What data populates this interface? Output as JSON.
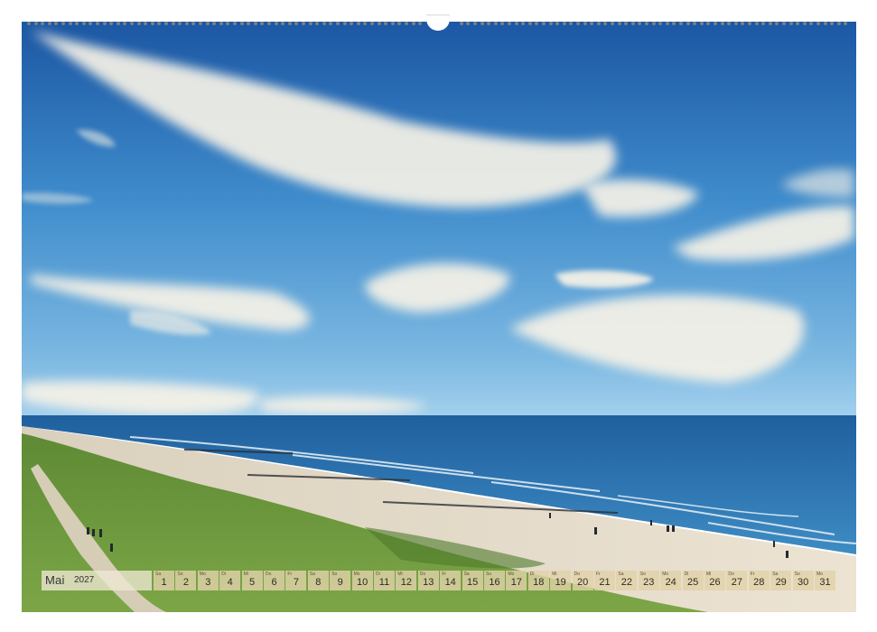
{
  "calendar": {
    "month": "Mai",
    "year": "2027",
    "days": [
      {
        "num": "1",
        "wd": "Sa"
      },
      {
        "num": "2",
        "wd": "So"
      },
      {
        "num": "3",
        "wd": "Mo"
      },
      {
        "num": "4",
        "wd": "Di"
      },
      {
        "num": "5",
        "wd": "Mi"
      },
      {
        "num": "6",
        "wd": "Do"
      },
      {
        "num": "7",
        "wd": "Fr"
      },
      {
        "num": "8",
        "wd": "Sa"
      },
      {
        "num": "9",
        "wd": "So"
      },
      {
        "num": "10",
        "wd": "Mo"
      },
      {
        "num": "11",
        "wd": "Di"
      },
      {
        "num": "12",
        "wd": "Mi"
      },
      {
        "num": "13",
        "wd": "Do"
      },
      {
        "num": "14",
        "wd": "Fr"
      },
      {
        "num": "15",
        "wd": "Sa"
      },
      {
        "num": "16",
        "wd": "So"
      },
      {
        "num": "17",
        "wd": "Mo"
      },
      {
        "num": "18",
        "wd": "Di"
      },
      {
        "num": "19",
        "wd": "Mi"
      },
      {
        "num": "20",
        "wd": "Do"
      },
      {
        "num": "21",
        "wd": "Fr"
      },
      {
        "num": "22",
        "wd": "Sa"
      },
      {
        "num": "23",
        "wd": "So"
      },
      {
        "num": "24",
        "wd": "Mo"
      },
      {
        "num": "25",
        "wd": "Di"
      },
      {
        "num": "26",
        "wd": "Mi"
      },
      {
        "num": "27",
        "wd": "Do"
      },
      {
        "num": "28",
        "wd": "Fr"
      },
      {
        "num": "29",
        "wd": "Sa"
      },
      {
        "num": "30",
        "wd": "So"
      },
      {
        "num": "31",
        "wd": "Mo"
      }
    ]
  },
  "colors": {
    "sky_top": "#1f5fa8",
    "sky_horizon": "#8fc3e6",
    "sea": "#2f78b5",
    "sand": "#e6dccb",
    "dune_green": "#6f9a3c",
    "day_cell": "#e0d2a8"
  }
}
